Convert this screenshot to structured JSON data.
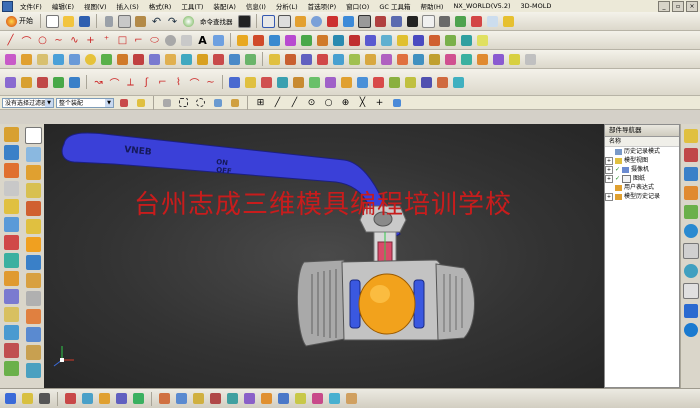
{
  "menu": {
    "items": [
      "文件(F)",
      "编辑(E)",
      "视图(V)",
      "插入(S)",
      "格式(R)",
      "工具(T)",
      "装配(A)",
      "信息(I)",
      "分析(L)",
      "首选项(P)",
      "窗口(O)",
      "GC 工具箱",
      "帮助(H)",
      "NX_WORLD(V5.2)",
      "3D-MOLD"
    ]
  },
  "toolbar": {
    "start_label": "开始",
    "command_finder": "命令查找器"
  },
  "selection_bar": {
    "filter_value": "没有选择过滤器",
    "scope_value": "整个装配"
  },
  "viewport": {
    "watermark": "台州志成三维模具编程培训学校",
    "handle_text_1": "VNEB",
    "handle_text_2": "ON",
    "handle_text_3": "OFF",
    "background": "#333333",
    "handle_color": "#3a40d8",
    "ball_color": "#f2a21c",
    "body_color": "#b9b9b9"
  },
  "navigator": {
    "title": "部件导航器",
    "column_header": "名称",
    "items": [
      {
        "toggle": "",
        "check": "",
        "label": "历史记录模式"
      },
      {
        "toggle": "+",
        "check": "",
        "label": "模型视图"
      },
      {
        "toggle": "+",
        "check": "✓",
        "label": "摄像机"
      },
      {
        "toggle": "+",
        "check": "✓",
        "label": "图纸"
      },
      {
        "toggle": "",
        "check": "",
        "label": "用户表达式"
      },
      {
        "toggle": "+",
        "check": "",
        "label": "模型历史记录"
      }
    ]
  },
  "icons": {
    "colors": [
      "#2f6fd6",
      "#e0a020",
      "#d23a2a",
      "#2fa84a",
      "#7a4ec8",
      "#3c3c3c",
      "#18a0c8",
      "#e06010"
    ]
  }
}
